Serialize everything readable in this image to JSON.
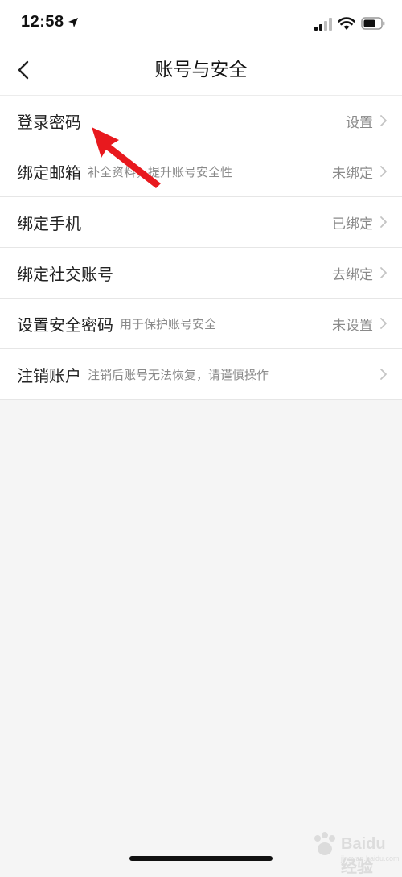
{
  "status_bar": {
    "time": "12:58"
  },
  "nav": {
    "title": "账号与安全"
  },
  "rows": [
    {
      "label": "登录密码",
      "hint": "",
      "value": "设置"
    },
    {
      "label": "绑定邮箱",
      "hint": "补全资料，提升账号安全性",
      "value": "未绑定"
    },
    {
      "label": "绑定手机",
      "hint": "",
      "value": "已绑定"
    },
    {
      "label": "绑定社交账号",
      "hint": "",
      "value": "去绑定"
    },
    {
      "label": "设置安全密码",
      "hint": "用于保护账号安全",
      "value": "未设置"
    },
    {
      "label": "注销账户",
      "hint": "注销后账号无法恢复，请谨慎操作",
      "value": ""
    }
  ],
  "watermark": {
    "text": "Baidu经验",
    "sub": "jingyan.baidu.com"
  },
  "colors": {
    "background": "#f5f5f5",
    "surface": "#ffffff",
    "annotation_arrow": "#e8191e",
    "secondary_text": "#8a8a8a"
  },
  "icons": {
    "status": [
      "location-icon",
      "signal-icon",
      "wifi-icon",
      "battery-icon"
    ],
    "back": "chevron-left-icon",
    "row_trailing": "chevron-right-icon"
  }
}
